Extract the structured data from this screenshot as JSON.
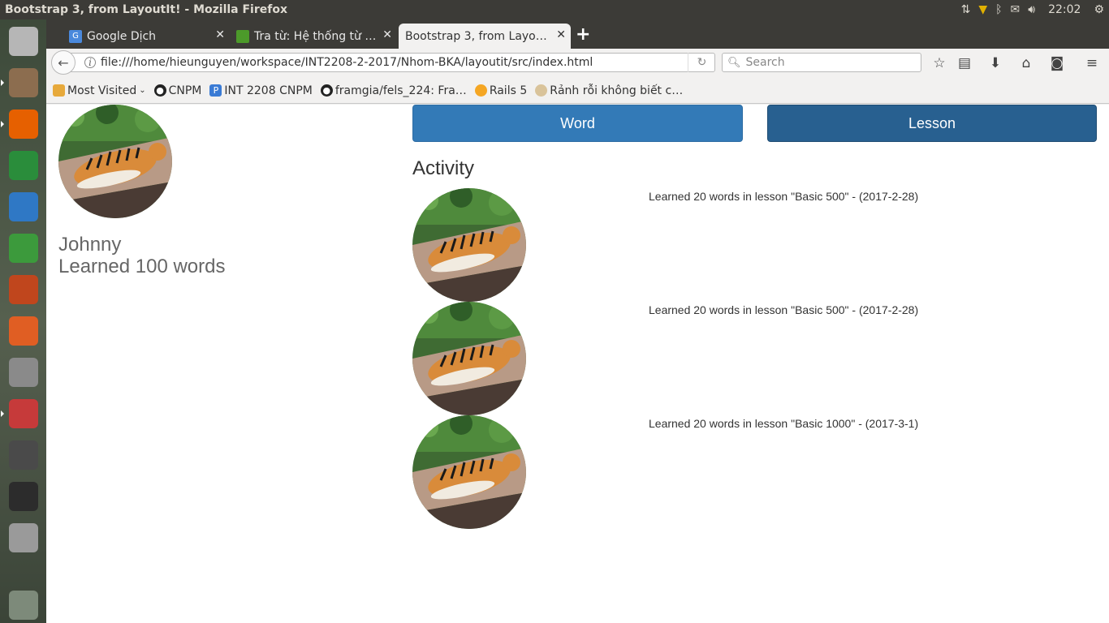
{
  "window": {
    "title": "Bootstrap 3, from LayoutIt! - Mozilla Firefox"
  },
  "tray": {
    "clock": "22:02"
  },
  "launcher": {
    "items": [
      {
        "name": "ubuntu-dash-icon",
        "color": "#b6b6b6"
      },
      {
        "name": "files-icon",
        "color": "#8c6d4f"
      },
      {
        "name": "firefox-icon",
        "color": "#e66000"
      },
      {
        "name": "chrome-icon",
        "color": "#2a8d3b"
      },
      {
        "name": "writer-icon",
        "color": "#2f78c5"
      },
      {
        "name": "calc-icon",
        "color": "#3c9a3c"
      },
      {
        "name": "impress-icon",
        "color": "#c0461d"
      },
      {
        "name": "software-center-icon",
        "color": "#e05e23"
      },
      {
        "name": "system-settings-icon",
        "color": "#8a8a8a"
      },
      {
        "name": "document-viewer-icon",
        "color": "#c63a3a"
      },
      {
        "name": "sublime-text-icon",
        "color": "#4a4a4a"
      },
      {
        "name": "terminal-icon",
        "color": "#2c2c2c"
      },
      {
        "name": "disk-icon",
        "color": "#9a9a9a"
      },
      {
        "name": "trash-icon",
        "color": "#7d8a7a"
      }
    ]
  },
  "tabs": [
    {
      "title": "Google Dịch",
      "icon": "google-translate-icon",
      "active": false
    },
    {
      "title": "Tra từ: Hệ thống từ …",
      "icon": "leaf-icon",
      "active": false
    },
    {
      "title": "Bootstrap 3, from Layo…",
      "icon": "none",
      "active": true
    }
  ],
  "nav": {
    "url": "file:///home/hieunguyen/workspace/INT2208-2-2017/Nhom-BKA/layoutit/src/index.html",
    "search_placeholder": "Search"
  },
  "bookmarks": [
    {
      "label": "Most Visited",
      "icon": "folder-icon"
    },
    {
      "label": "CNPM",
      "icon": "github-icon"
    },
    {
      "label": "INT 2208 CNPM",
      "icon": "p-icon"
    },
    {
      "label": "framgia/fels_224: Fra…",
      "icon": "github-icon"
    },
    {
      "label": "Rails 5",
      "icon": "rails-icon"
    },
    {
      "label": "Rảnh rỗi không biết c…",
      "icon": "face-icon"
    }
  ],
  "profile": {
    "name": "Johnny",
    "learned": "Learned 100 words"
  },
  "buttons": {
    "word": "Word",
    "lesson": "Lesson"
  },
  "activity": {
    "title": "Activity",
    "items": [
      {
        "text": "Learned 20 words in lesson \"Basic 500\" - (2017-2-28)"
      },
      {
        "text": "Learned 20 words in lesson \"Basic 500\" - (2017-2-28)"
      },
      {
        "text": "Learned 20 words in lesson \"Basic 1000\" - (2017-3-1)"
      }
    ]
  }
}
